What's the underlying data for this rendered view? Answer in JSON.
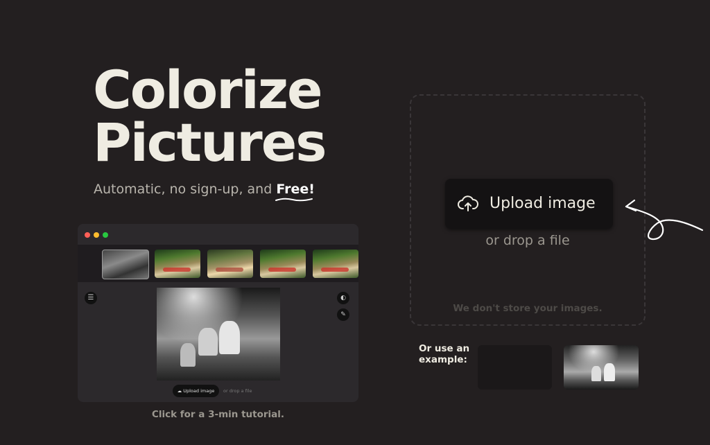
{
  "hero": {
    "title_line1": "Colorize",
    "title_line2": "Pictures",
    "subtitle_prefix": "Automatic, no sign-up, and ",
    "subtitle_emphasis": "Free!"
  },
  "demo": {
    "traffic_light_colors": [
      "#ff5f57",
      "#febc2e",
      "#28c840"
    ],
    "upload_label": "Upload image",
    "drop_label": "or drop a file",
    "tutorial_text": "Click for a 3-min tutorial."
  },
  "upload": {
    "button_label": "Upload image",
    "drop_text": "or drop a file",
    "privacy_text": "We don't store your images."
  },
  "examples": {
    "label": "Or use an example:"
  },
  "colors": {
    "background": "#231f20",
    "title": "#efece2",
    "button_bg": "#141213"
  }
}
